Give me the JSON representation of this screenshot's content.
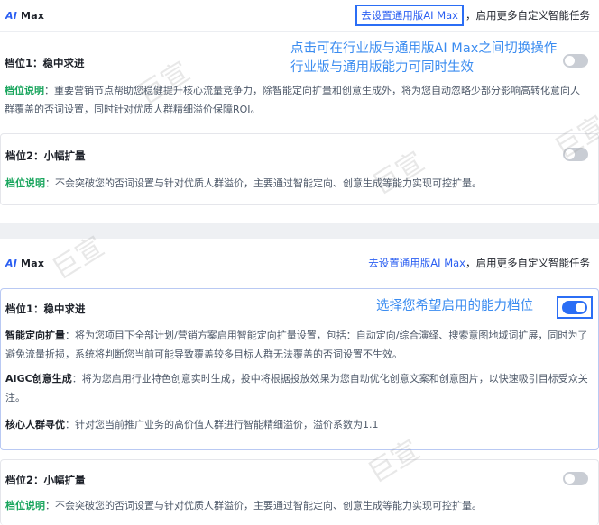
{
  "logo": {
    "mark": "AI",
    "text": "Max"
  },
  "top_panel": {
    "header_link": "去设置通用版AI Max",
    "header_tail": "，启用更多自定义智能任务",
    "annotation_lines": [
      "点击可在行业版与通用版AI Max之间切换操作",
      "行业版与通用版能力可同时生效"
    ],
    "tier1": {
      "title": "档位1：稳中求进",
      "label": "档位说明",
      "text": "：重要营销节点帮助您稳健提升核心流量竞争力，除智能定向扩量和创意生成外，将为您自动忽略少部分影响高转化意向人群覆盖的否词设置，同时针对优质人群精细溢价保障ROI。",
      "toggle_on": false
    },
    "tier2": {
      "title": "档位2：小幅扩量",
      "label": "档位说明",
      "text": "：不会突破您的否词设置与针对优质人群溢价，主要通过智能定向、创意生成等能力实现可控扩量。",
      "toggle_on": false
    }
  },
  "bottom_panel": {
    "header_link": "去设置通用版AI Max",
    "header_tail": "，启用更多自定义智能任务",
    "annotation": "选择您希望启用的能力档位",
    "tier1": {
      "title": "档位1：稳中求进",
      "toggle_on": true,
      "features": [
        {
          "name": "智能定向扩量",
          "text": "：将为您项目下全部计划/营销方案启用智能定向扩量设置，包括：自动定向/综合演绎、搜索意图地域词扩展，同时为了避免流量折损，系统将判断您当前可能导致覆盖较多目标人群无法覆盖的否词设置不生效。"
        },
        {
          "name": "AIGC创意生成",
          "text": "：将为您启用行业特色创意实时生成，投中将根据投放效果为您自动优化创意文案和创意图片，以快速吸引目标受众关注。"
        },
        {
          "name": "核心人群寻优",
          "text": "：针对您当前推广业务的高价值人群进行智能精细溢价，溢价系数为1.1"
        }
      ]
    },
    "tier2": {
      "title": "档位2：小幅扩量",
      "label": "档位说明",
      "text": "：不会突破您的否词设置与针对优质人群溢价，主要通过智能定向、创意生成等能力实现可控扩量。",
      "toggle_on": false
    }
  },
  "watermarks": [
    "巨宣",
    "巨宣",
    "巨宣",
    "巨宣",
    "巨宣"
  ],
  "colors": {
    "accent": "#2b6ef5",
    "label_green": "#19a55d",
    "annotation": "#3b8cf0"
  }
}
